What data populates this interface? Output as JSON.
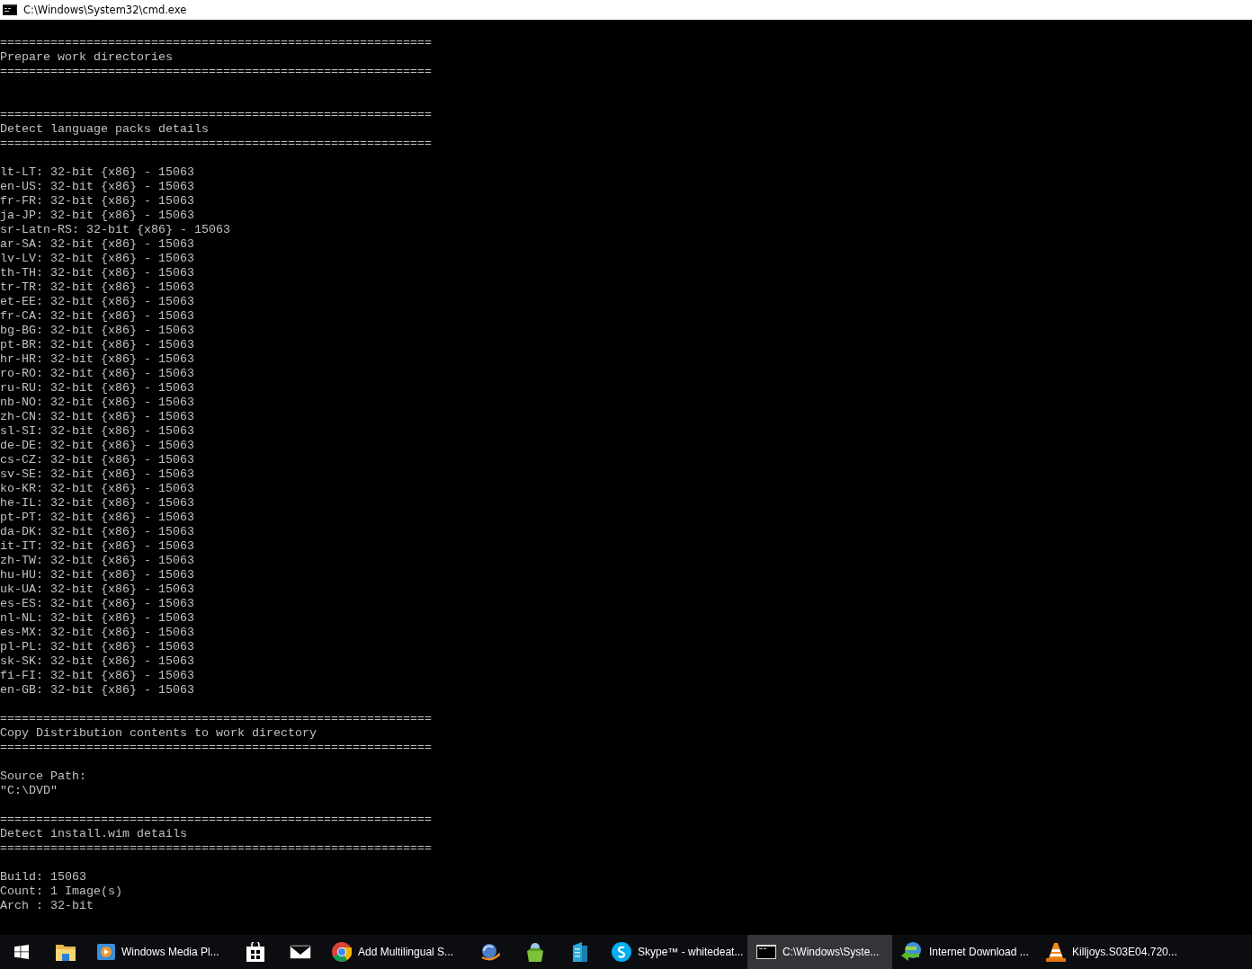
{
  "window": {
    "title": "C:\\Windows\\System32\\cmd.exe"
  },
  "console": {
    "lines": [
      {
        "kind": "blank"
      },
      {
        "kind": "text",
        "text": "============================================================"
      },
      {
        "kind": "text",
        "text": "Prepare work directories"
      },
      {
        "kind": "text",
        "text": "============================================================"
      },
      {
        "kind": "blank"
      },
      {
        "kind": "blank"
      },
      {
        "kind": "text",
        "text": "============================================================"
      },
      {
        "kind": "text",
        "text": "Detect language packs details"
      },
      {
        "kind": "text",
        "text": "============================================================"
      },
      {
        "kind": "blank"
      },
      {
        "kind": "text",
        "text": "lt-LT: 32-bit {x86} - 15063"
      },
      {
        "kind": "text",
        "text": "en-US: 32-bit {x86} - 15063"
      },
      {
        "kind": "text",
        "text": "fr-FR: 32-bit {x86} - 15063"
      },
      {
        "kind": "text",
        "text": "ja-JP: 32-bit {x86} - 15063"
      },
      {
        "kind": "text",
        "text": "sr-Latn-RS: 32-bit {x86} - 15063"
      },
      {
        "kind": "text",
        "text": "ar-SA: 32-bit {x86} - 15063"
      },
      {
        "kind": "text",
        "text": "lv-LV: 32-bit {x86} - 15063"
      },
      {
        "kind": "text",
        "text": "th-TH: 32-bit {x86} - 15063"
      },
      {
        "kind": "text",
        "text": "tr-TR: 32-bit {x86} - 15063"
      },
      {
        "kind": "text",
        "text": "et-EE: 32-bit {x86} - 15063"
      },
      {
        "kind": "text",
        "text": "fr-CA: 32-bit {x86} - 15063"
      },
      {
        "kind": "text",
        "text": "bg-BG: 32-bit {x86} - 15063"
      },
      {
        "kind": "text",
        "text": "pt-BR: 32-bit {x86} - 15063"
      },
      {
        "kind": "text",
        "text": "hr-HR: 32-bit {x86} - 15063"
      },
      {
        "kind": "text",
        "text": "ro-RO: 32-bit {x86} - 15063"
      },
      {
        "kind": "text",
        "text": "ru-RU: 32-bit {x86} - 15063"
      },
      {
        "kind": "text",
        "text": "nb-NO: 32-bit {x86} - 15063"
      },
      {
        "kind": "text",
        "text": "zh-CN: 32-bit {x86} - 15063"
      },
      {
        "kind": "text",
        "text": "sl-SI: 32-bit {x86} - 15063"
      },
      {
        "kind": "text",
        "text": "de-DE: 32-bit {x86} - 15063"
      },
      {
        "kind": "text",
        "text": "cs-CZ: 32-bit {x86} - 15063"
      },
      {
        "kind": "text",
        "text": "sv-SE: 32-bit {x86} - 15063"
      },
      {
        "kind": "text",
        "text": "ko-KR: 32-bit {x86} - 15063"
      },
      {
        "kind": "text",
        "text": "he-IL: 32-bit {x86} - 15063"
      },
      {
        "kind": "text",
        "text": "pt-PT: 32-bit {x86} - 15063"
      },
      {
        "kind": "text",
        "text": "da-DK: 32-bit {x86} - 15063"
      },
      {
        "kind": "text",
        "text": "it-IT: 32-bit {x86} - 15063"
      },
      {
        "kind": "text",
        "text": "zh-TW: 32-bit {x86} - 15063"
      },
      {
        "kind": "text",
        "text": "hu-HU: 32-bit {x86} - 15063"
      },
      {
        "kind": "text",
        "text": "uk-UA: 32-bit {x86} - 15063"
      },
      {
        "kind": "text",
        "text": "es-ES: 32-bit {x86} - 15063"
      },
      {
        "kind": "text",
        "text": "nl-NL: 32-bit {x86} - 15063"
      },
      {
        "kind": "text",
        "text": "es-MX: 32-bit {x86} - 15063"
      },
      {
        "kind": "text",
        "text": "pl-PL: 32-bit {x86} - 15063"
      },
      {
        "kind": "text",
        "text": "sk-SK: 32-bit {x86} - 15063"
      },
      {
        "kind": "text",
        "text": "fi-FI: 32-bit {x86} - 15063"
      },
      {
        "kind": "text",
        "text": "en-GB: 32-bit {x86} - 15063"
      },
      {
        "kind": "blank"
      },
      {
        "kind": "text",
        "text": "============================================================"
      },
      {
        "kind": "text",
        "text": "Copy Distribution contents to work directory"
      },
      {
        "kind": "text",
        "text": "============================================================"
      },
      {
        "kind": "blank"
      },
      {
        "kind": "text",
        "text": "Source Path:"
      },
      {
        "kind": "text",
        "text": "\"C:\\DVD\""
      },
      {
        "kind": "blank"
      },
      {
        "kind": "text",
        "text": "============================================================"
      },
      {
        "kind": "text",
        "text": "Detect install.wim details"
      },
      {
        "kind": "text",
        "text": "============================================================"
      },
      {
        "kind": "blank"
      },
      {
        "kind": "text",
        "text": "Build: 15063"
      },
      {
        "kind": "text",
        "text": "Count: 1 Image(s)"
      },
      {
        "kind": "text",
        "text": "Arch : 32-bit"
      }
    ]
  },
  "taskbar": {
    "items": [
      {
        "kind": "start"
      },
      {
        "kind": "pinned",
        "selected": false
      },
      {
        "kind": "window",
        "label": "Windows Media Pl...",
        "selected": false
      },
      {
        "kind": "pinned",
        "selected": false
      },
      {
        "kind": "pinned",
        "selected": false
      },
      {
        "kind": "window",
        "label": "Add Multilingual S...",
        "selected": false
      },
      {
        "kind": "pinned",
        "selected": false
      },
      {
        "kind": "pinned",
        "selected": false
      },
      {
        "kind": "pinned",
        "selected": false
      },
      {
        "kind": "window",
        "label": "Skype™ - whitedeat...",
        "selected": false
      },
      {
        "kind": "window",
        "label": "C:\\Windows\\Syste...",
        "selected": true
      },
      {
        "kind": "window",
        "label": "Internet Download ...",
        "selected": false
      },
      {
        "kind": "window",
        "label": "Killjoys.S03E04.720...",
        "selected": false
      }
    ]
  }
}
